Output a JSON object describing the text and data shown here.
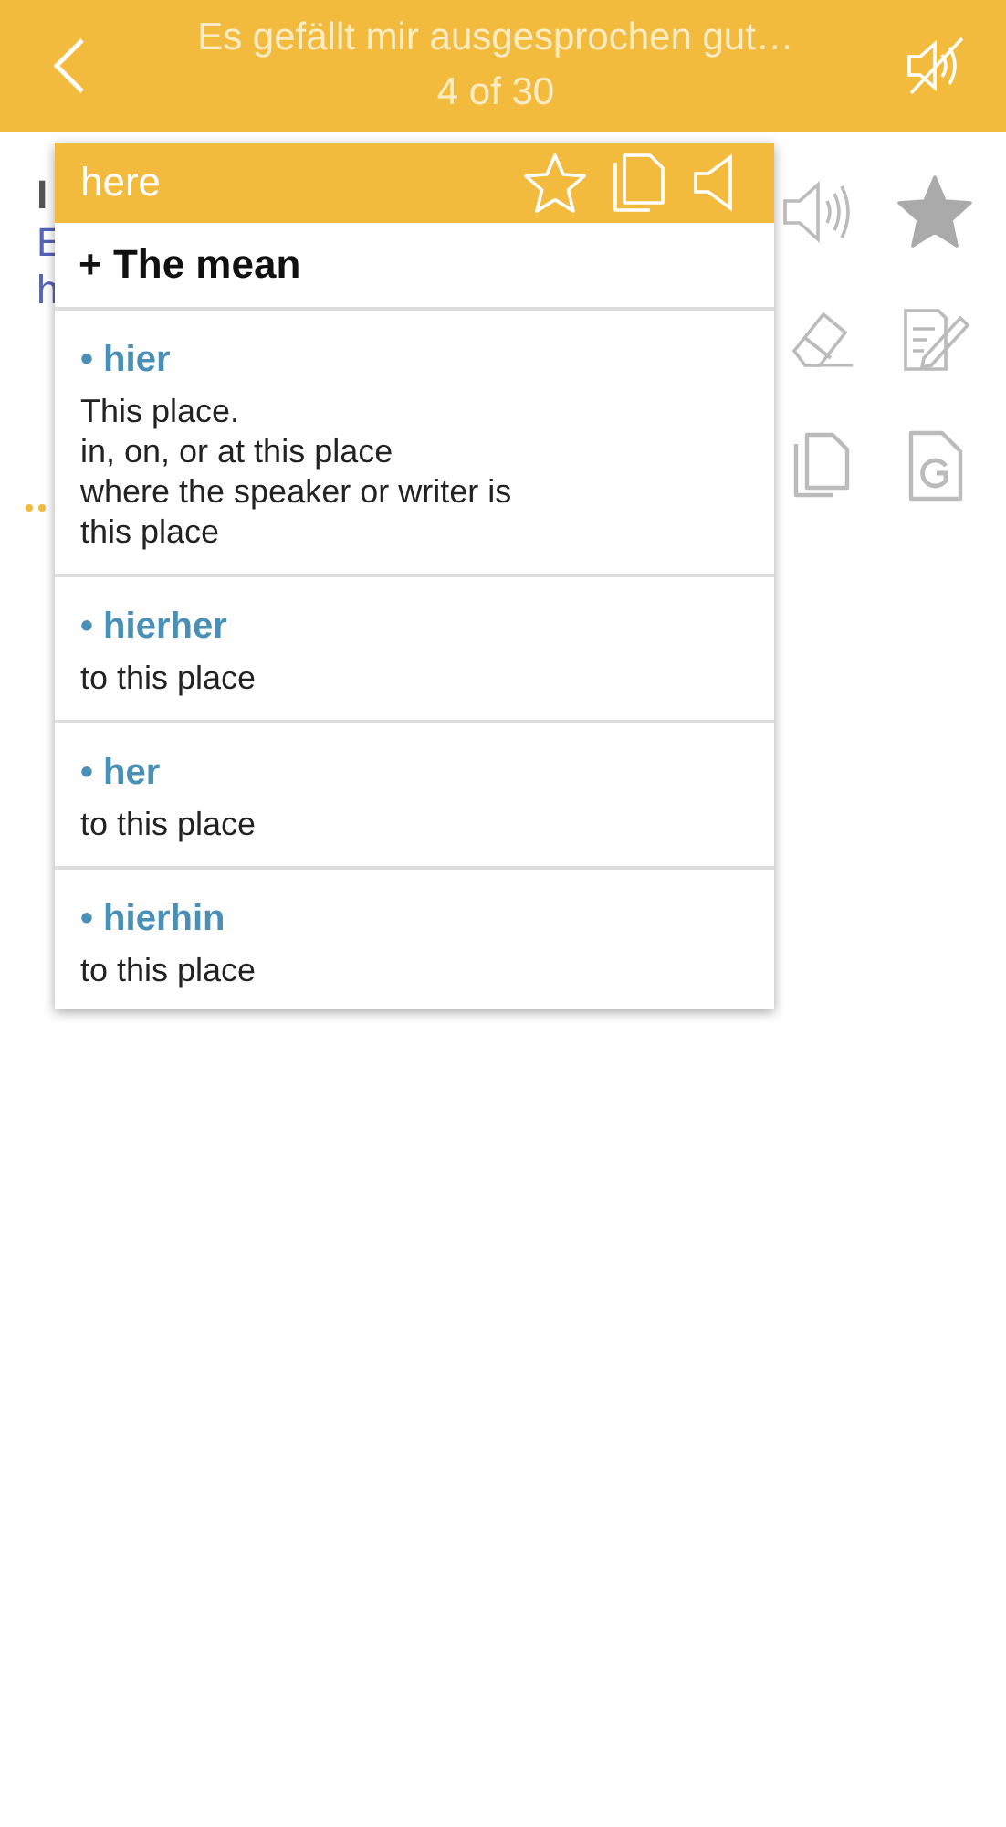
{
  "header": {
    "title": "Es gefällt mir ausgesprochen gut…",
    "counter": "4 of 30",
    "sound_muted": true
  },
  "background": {
    "fragments": [
      {
        "text": "I",
        "kind": "heading"
      },
      {
        "text": "E",
        "kind": "link"
      },
      {
        "text": "h",
        "kind": "link"
      }
    ],
    "favorite": true
  },
  "popup": {
    "word": "here",
    "favorite": false,
    "section": "+ The mean",
    "entries": [
      {
        "term": "• hier",
        "definitions": [
          "This place.",
          "in, on, or at this place",
          "where the speaker or writer is",
          "this place"
        ]
      },
      {
        "term": "• hierher",
        "definitions": [
          "to this place"
        ]
      },
      {
        "term": "• her",
        "definitions": [
          "to this place"
        ]
      },
      {
        "term": "• hierhin",
        "definitions": [
          "to this place"
        ]
      }
    ]
  }
}
